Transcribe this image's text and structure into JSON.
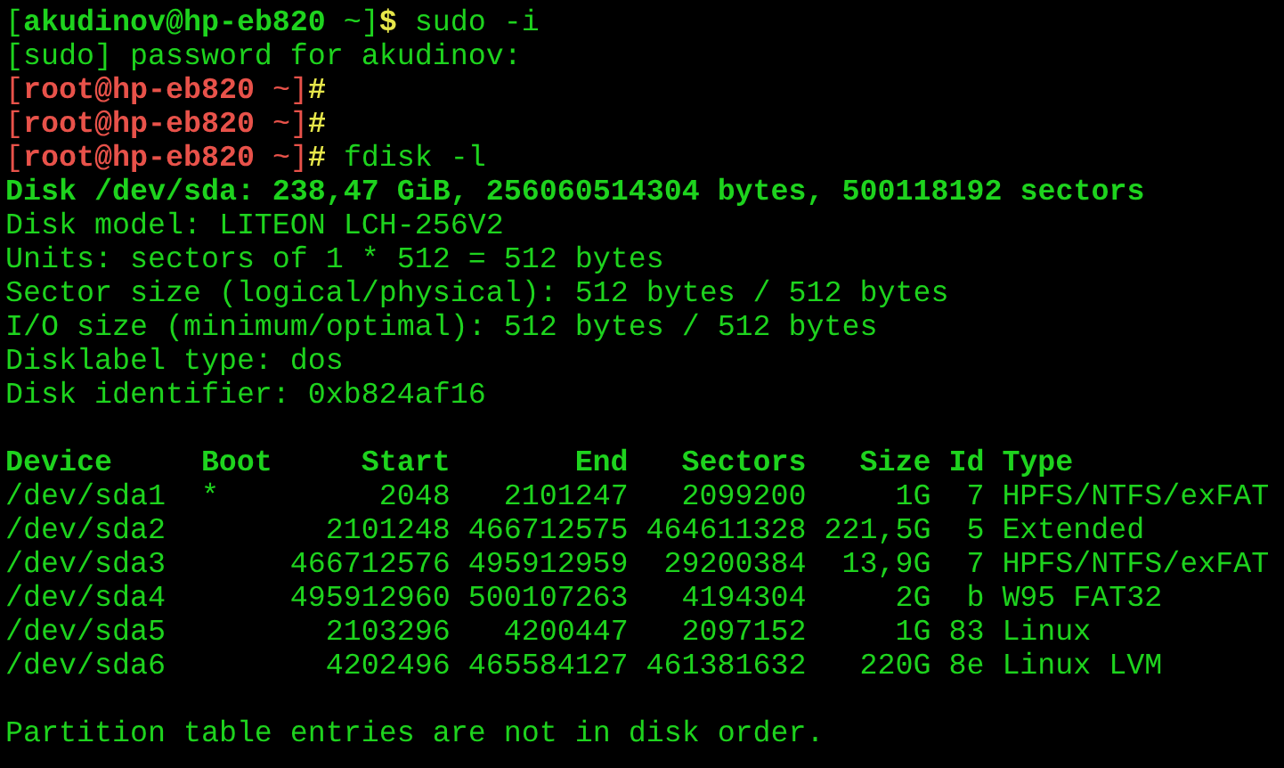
{
  "terminal": {
    "lines": [
      {
        "kind": "prompt",
        "privileged": false,
        "open": "[",
        "identity": "akudinov@hp-eb820",
        "close": " ~]",
        "symbol": "$",
        "command": "sudo -i"
      },
      {
        "kind": "output",
        "text": "[sudo] password for akudinov:",
        "bold": false
      },
      {
        "kind": "prompt",
        "privileged": true,
        "open": "[",
        "identity": "root@hp-eb820",
        "close": " ~]",
        "symbol": "#"
      },
      {
        "kind": "prompt",
        "privileged": true,
        "open": "[",
        "identity": "root@hp-eb820",
        "close": " ~]",
        "symbol": "#"
      },
      {
        "kind": "prompt",
        "privileged": true,
        "open": "[",
        "identity": "root@hp-eb820",
        "close": " ~]",
        "symbol": "#",
        "command": "fdisk -l"
      },
      {
        "kind": "output",
        "text": "Disk /dev/sda: 238,47 GiB, 256060514304 bytes, 500118192 sectors",
        "bold": true
      },
      {
        "kind": "output",
        "text": "Disk model: LITEON LCH-256V2",
        "bold": false
      },
      {
        "kind": "output",
        "text": "Units: sectors of 1 * 512 = 512 bytes",
        "bold": false
      },
      {
        "kind": "output",
        "text": "Sector size (logical/physical): 512 bytes / 512 bytes",
        "bold": false
      },
      {
        "kind": "output",
        "text": "I/O size (minimum/optimal): 512 bytes / 512 bytes",
        "bold": false
      },
      {
        "kind": "output",
        "text": "Disklabel type: dos",
        "bold": false
      },
      {
        "kind": "output",
        "text": "Disk identifier: 0xb824af16",
        "bold": false
      },
      {
        "kind": "blank"
      },
      {
        "kind": "table",
        "columns": [
          "Device",
          "Boot",
          "Start",
          "End",
          "Sectors",
          "Size",
          "Id",
          "Type"
        ],
        "rows": [
          [
            "/dev/sda1",
            "*",
            "2048",
            "2101247",
            "2099200",
            "1G",
            "7",
            "HPFS/NTFS/exFAT"
          ],
          [
            "/dev/sda2",
            "",
            "2101248",
            "466712575",
            "464611328",
            "221,5G",
            "5",
            "Extended"
          ],
          [
            "/dev/sda3",
            "",
            "466712576",
            "495912959",
            "29200384",
            "13,9G",
            "7",
            "HPFS/NTFS/exFAT"
          ],
          [
            "/dev/sda4",
            "",
            "495912960",
            "500107263",
            "4194304",
            "2G",
            "b",
            "W95 FAT32"
          ],
          [
            "/dev/sda5",
            "",
            "2103296",
            "4200447",
            "2097152",
            "1G",
            "83",
            "Linux"
          ],
          [
            "/dev/sda6",
            "",
            "4202496",
            "465584127",
            "461381632",
            "220G",
            "8e",
            "Linux LVM"
          ]
        ]
      },
      {
        "kind": "blank"
      },
      {
        "kind": "output",
        "text": "Partition table entries are not in disk order.",
        "bold": false
      }
    ]
  }
}
